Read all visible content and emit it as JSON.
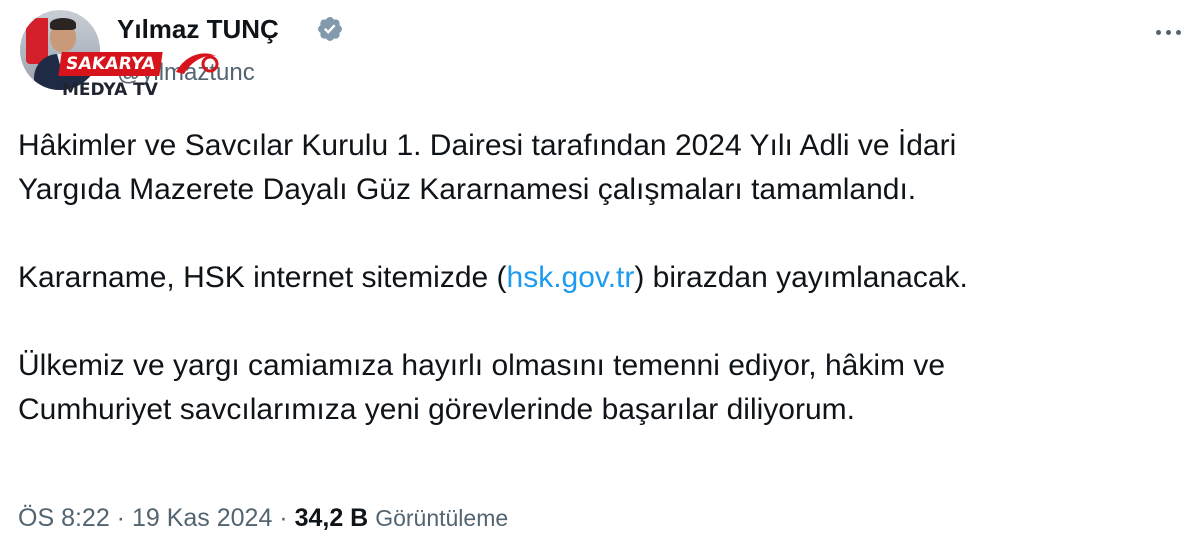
{
  "author": {
    "display_name": "Yılmaz TUNÇ",
    "handle": "@yilmaztunc",
    "verified_icon": "verified-badge-icon"
  },
  "watermark": {
    "brand": "SAKARYA",
    "sub": "MEDYA TV"
  },
  "tweet": {
    "line1": "Hâkimler ve Savcılar Kurulu 1. Dairesi tarafından 2024 Yılı Adli ve İdari",
    "line2": "Yargıda Mazerete Dayalı Güz Kararnamesi çalışmaları tamamlandı.",
    "p2_before": "Kararname, HSK internet sitemizde (",
    "p2_link": "hsk.gov.tr",
    "p2_after": ") birazdan yayımlanacak.",
    "line4": "Ülkemiz ve yargı camiamıza hayırlı olmasını temenni ediyor, hâkim ve",
    "line5": "Cumhuriyet savcılarımıza yeni görevlerinde başarılar diliyorum."
  },
  "meta": {
    "time": "ÖS 8:22",
    "sep": " · ",
    "date": "19 Kas 2024",
    "views_count": "34,2 B",
    "views_label": "Görüntüleme"
  },
  "colors": {
    "text": "#0f1419",
    "secondary": "#536471",
    "link": "#1d9bf0",
    "verified": "#829aab",
    "watermark_red": "#d7141b"
  }
}
